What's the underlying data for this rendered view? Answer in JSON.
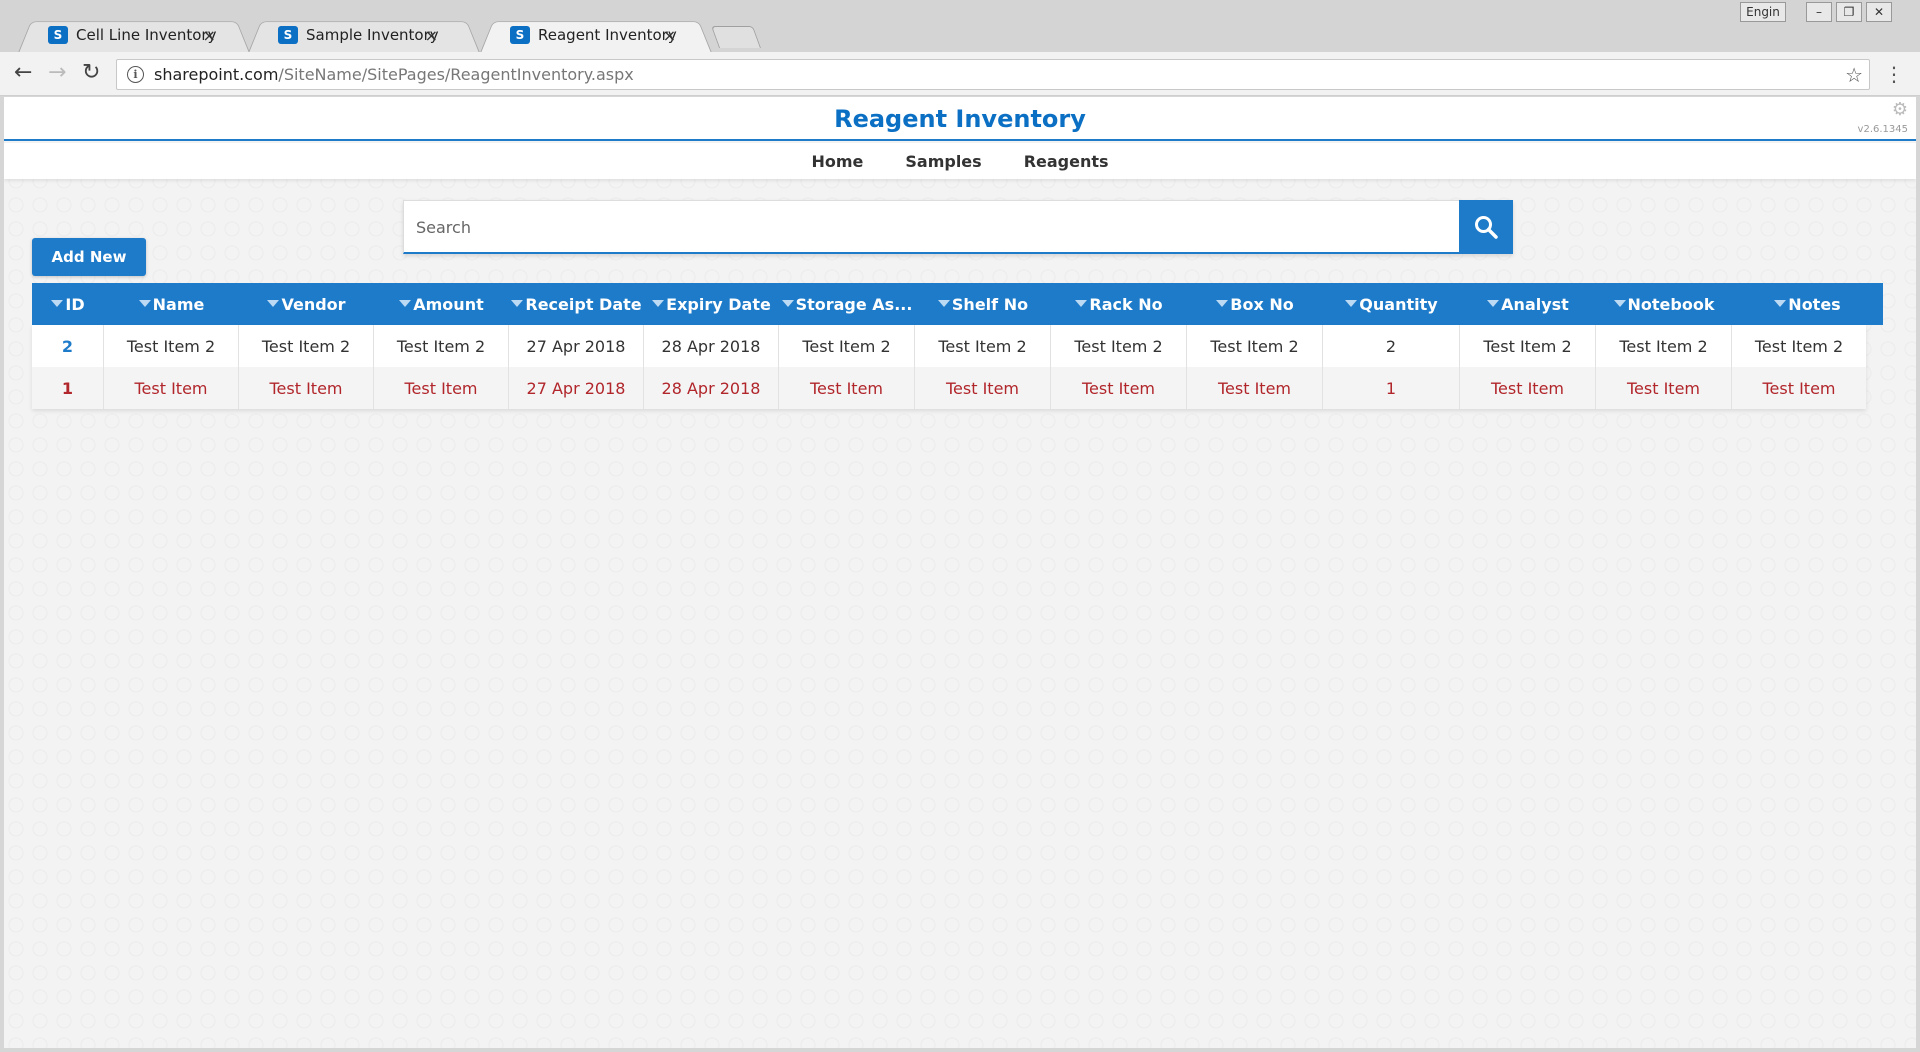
{
  "browser": {
    "tabs": [
      {
        "label": "Cell Line Inventory",
        "favicon": "sharepoint-icon"
      },
      {
        "label": "Sample Inventory",
        "favicon": "sharepoint-icon"
      },
      {
        "label": "Reagent Inventory",
        "favicon": "sharepoint-icon",
        "active": true
      }
    ],
    "tab_close_glyph": "×",
    "user_badge": "Engin",
    "url_host": "sharepoint.com",
    "url_path": "/SiteName/SitePages/ReagentInventory.aspx"
  },
  "header": {
    "title": "Reagent Inventory",
    "version": "v2.6.1345"
  },
  "nav": {
    "items": [
      "Home",
      "Samples",
      "Reagents"
    ]
  },
  "search": {
    "placeholder": "Search"
  },
  "toolbar": {
    "add_label": "Add New"
  },
  "grid": {
    "columns": [
      "ID",
      "Name",
      "Vendor",
      "Amount",
      "Receipt Date",
      "Expiry Date",
      "Storage As...",
      "Shelf No",
      "Rack No",
      "Box No",
      "Quantity",
      "Analyst",
      "Notebook",
      "Notes"
    ],
    "rows": [
      [
        "2",
        "Test Item 2",
        "Test Item 2",
        "Test Item 2",
        "27 Apr 2018",
        "28 Apr 2018",
        "Test Item 2",
        "Test Item 2",
        "Test Item 2",
        "Test Item 2",
        "2",
        "Test Item 2",
        "Test Item 2",
        "Test Item 2"
      ],
      [
        "1",
        "Test Item",
        "Test Item",
        "Test Item",
        "27 Apr 2018",
        "28 Apr 2018",
        "Test Item",
        "Test Item",
        "Test Item",
        "Test Item",
        "1",
        "Test Item",
        "Test Item",
        "Test Item"
      ]
    ]
  },
  "colors": {
    "accent": "#1e7bc9",
    "title": "#0b6fc4",
    "expired_row_text": "#b1262b"
  }
}
